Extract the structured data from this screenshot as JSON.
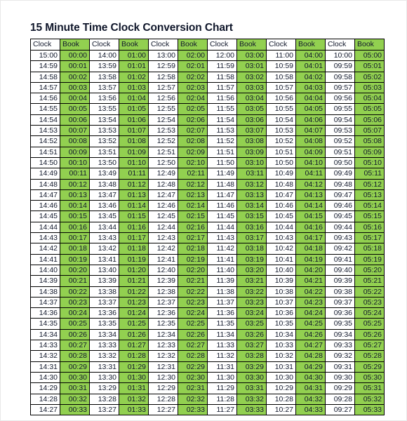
{
  "document": {
    "title": "15 Minute Time Clock Conversion Chart"
  },
  "colors": {
    "book_green": "#92d050",
    "clock_white": "#ffffff",
    "grid_line": "#000000",
    "text": "#10172b",
    "page_border": "#e8e8e8"
  },
  "table": {
    "column_headers": [
      "Clock",
      "Book",
      "Clock",
      "Book",
      "Clock",
      "Book",
      "Clock",
      "Book",
      "Clock",
      "Book",
      "Clock",
      "Book"
    ],
    "column_types": [
      "clock",
      "book",
      "clock",
      "book",
      "clock",
      "book",
      "clock",
      "book",
      "clock",
      "book",
      "clock",
      "book"
    ],
    "pair_count": 6,
    "row_count": 34,
    "rows": [
      [
        "15:00",
        "00:00",
        "14:00",
        "01:00",
        "13:00",
        "02:00",
        "12:00",
        "03:00",
        "11:00",
        "04:00",
        "10:00",
        "05:00"
      ],
      [
        "14:59",
        "00:01",
        "13:59",
        "01:01",
        "12:59",
        "02:01",
        "11:59",
        "03:01",
        "10:59",
        "04:01",
        "09:59",
        "05:01"
      ],
      [
        "14:58",
        "00:02",
        "13:58",
        "01:02",
        "12:58",
        "02:02",
        "11:58",
        "03:02",
        "10:58",
        "04:02",
        "09:58",
        "05:02"
      ],
      [
        "14:57",
        "00:03",
        "13:57",
        "01:03",
        "12:57",
        "02:03",
        "11:57",
        "03:03",
        "10:57",
        "04:03",
        "09:57",
        "05:03"
      ],
      [
        "14:56",
        "00:04",
        "13:56",
        "01:04",
        "12:56",
        "02:04",
        "11:56",
        "03:04",
        "10:56",
        "04:04",
        "09:56",
        "05:04"
      ],
      [
        "14:55",
        "00:05",
        "13:55",
        "01:05",
        "12:55",
        "02:05",
        "11:55",
        "03:05",
        "10:55",
        "04:05",
        "09:55",
        "05:05"
      ],
      [
        "14:54",
        "00:06",
        "13:54",
        "01:06",
        "12:54",
        "02:06",
        "11:54",
        "03:06",
        "10:54",
        "04:06",
        "09:54",
        "05:06"
      ],
      [
        "14:53",
        "00:07",
        "13:53",
        "01:07",
        "12:53",
        "02:07",
        "11:53",
        "03:07",
        "10:53",
        "04:07",
        "09:53",
        "05:07"
      ],
      [
        "14:52",
        "00:08",
        "13:52",
        "01:08",
        "12:52",
        "02:08",
        "11:52",
        "03:08",
        "10:52",
        "04:08",
        "09:52",
        "05:08"
      ],
      [
        "14:51",
        "00:09",
        "13:51",
        "01:09",
        "12:51",
        "02:09",
        "11:51",
        "03:09",
        "10:51",
        "04:09",
        "09:51",
        "05:09"
      ],
      [
        "14:50",
        "00:10",
        "13:50",
        "01:10",
        "12:50",
        "02:10",
        "11:50",
        "03:10",
        "10:50",
        "04:10",
        "09:50",
        "05:10"
      ],
      [
        "14:49",
        "00:11",
        "13:49",
        "01:11",
        "12:49",
        "02:11",
        "11:49",
        "03:11",
        "10:49",
        "04:11",
        "09:49",
        "05:11"
      ],
      [
        "14:48",
        "00:12",
        "13:48",
        "01:12",
        "12:48",
        "02:12",
        "11:48",
        "03:12",
        "10:48",
        "04:12",
        "09:48",
        "05:12"
      ],
      [
        "14:47",
        "00:13",
        "13:47",
        "01:13",
        "12:47",
        "02:13",
        "11:47",
        "03:13",
        "10:47",
        "04:13",
        "09:47",
        "05:13"
      ],
      [
        "14:46",
        "00:14",
        "13:46",
        "01:14",
        "12:46",
        "02:14",
        "11:46",
        "03:14",
        "10:46",
        "04:14",
        "09:46",
        "05:14"
      ],
      [
        "14:45",
        "00:15",
        "13:45",
        "01:15",
        "12:45",
        "02:15",
        "11:45",
        "03:15",
        "10:45",
        "04:15",
        "09:45",
        "05:15"
      ],
      [
        "14:44",
        "00:16",
        "13:44",
        "01:16",
        "12:44",
        "02:16",
        "11:44",
        "03:16",
        "10:44",
        "04:16",
        "09:44",
        "05:16"
      ],
      [
        "14:43",
        "00:17",
        "13:43",
        "01:17",
        "12:43",
        "02:17",
        "11:43",
        "03:17",
        "10:43",
        "04:17",
        "09:43",
        "05:17"
      ],
      [
        "14:42",
        "00:18",
        "13:42",
        "01:18",
        "12:42",
        "02:18",
        "11:42",
        "03:18",
        "10:42",
        "04:18",
        "09:42",
        "05:18"
      ],
      [
        "14:41",
        "00:19",
        "13:41",
        "01:19",
        "12:41",
        "02:19",
        "11:41",
        "03:19",
        "10:41",
        "04:19",
        "09:41",
        "05:19"
      ],
      [
        "14:40",
        "00:20",
        "13:40",
        "01:20",
        "12:40",
        "02:20",
        "11:40",
        "03:20",
        "10:40",
        "04:20",
        "09:40",
        "05:20"
      ],
      [
        "14:39",
        "00:21",
        "13:39",
        "01:21",
        "12:39",
        "02:21",
        "11:39",
        "03:21",
        "10:39",
        "04:21",
        "09:39",
        "05:21"
      ],
      [
        "14:38",
        "00:22",
        "13:38",
        "01:22",
        "12:38",
        "02:22",
        "11:38",
        "03:22",
        "10:38",
        "04:22",
        "09:38",
        "05:22"
      ],
      [
        "14:37",
        "00:23",
        "13:37",
        "01:23",
        "12:37",
        "02:23",
        "11:37",
        "03:23",
        "10:37",
        "04:23",
        "09:37",
        "05:23"
      ],
      [
        "14:36",
        "00:24",
        "13:36",
        "01:24",
        "12:36",
        "02:24",
        "11:36",
        "03:24",
        "10:36",
        "04:24",
        "09:36",
        "05:24"
      ],
      [
        "14:35",
        "00:25",
        "13:35",
        "01:25",
        "12:35",
        "02:25",
        "11:35",
        "03:25",
        "10:35",
        "04:25",
        "09:35",
        "05:25"
      ],
      [
        "14:34",
        "00:26",
        "13:34",
        "01:26",
        "12:34",
        "02:26",
        "11:34",
        "03:26",
        "10:34",
        "04:26",
        "09:34",
        "05:26"
      ],
      [
        "14:33",
        "00:27",
        "13:33",
        "01:27",
        "12:33",
        "02:27",
        "11:33",
        "03:27",
        "10:33",
        "04:27",
        "09:33",
        "05:27"
      ],
      [
        "14:32",
        "00:28",
        "13:32",
        "01:28",
        "12:32",
        "02:28",
        "11:32",
        "03:28",
        "10:32",
        "04:28",
        "09:32",
        "05:28"
      ],
      [
        "14:31",
        "00:29",
        "13:31",
        "01:29",
        "12:31",
        "02:29",
        "11:31",
        "03:29",
        "10:31",
        "04:29",
        "09:31",
        "05:29"
      ],
      [
        "14:30",
        "00:30",
        "13:30",
        "01:30",
        "12:30",
        "02:30",
        "11:30",
        "03:30",
        "10:30",
        "04:30",
        "09:30",
        "05:30"
      ],
      [
        "14:29",
        "00:31",
        "13:29",
        "01:31",
        "12:29",
        "02:31",
        "11:29",
        "03:31",
        "10:29",
        "04:31",
        "09:29",
        "05:31"
      ],
      [
        "14:28",
        "00:32",
        "13:28",
        "01:32",
        "12:28",
        "02:32",
        "11:28",
        "03:32",
        "10:28",
        "04:32",
        "09:28",
        "05:32"
      ],
      [
        "14:27",
        "00:33",
        "13:27",
        "01:33",
        "12:27",
        "02:33",
        "11:27",
        "03:33",
        "10:27",
        "04:33",
        "09:27",
        "05:33"
      ]
    ]
  }
}
